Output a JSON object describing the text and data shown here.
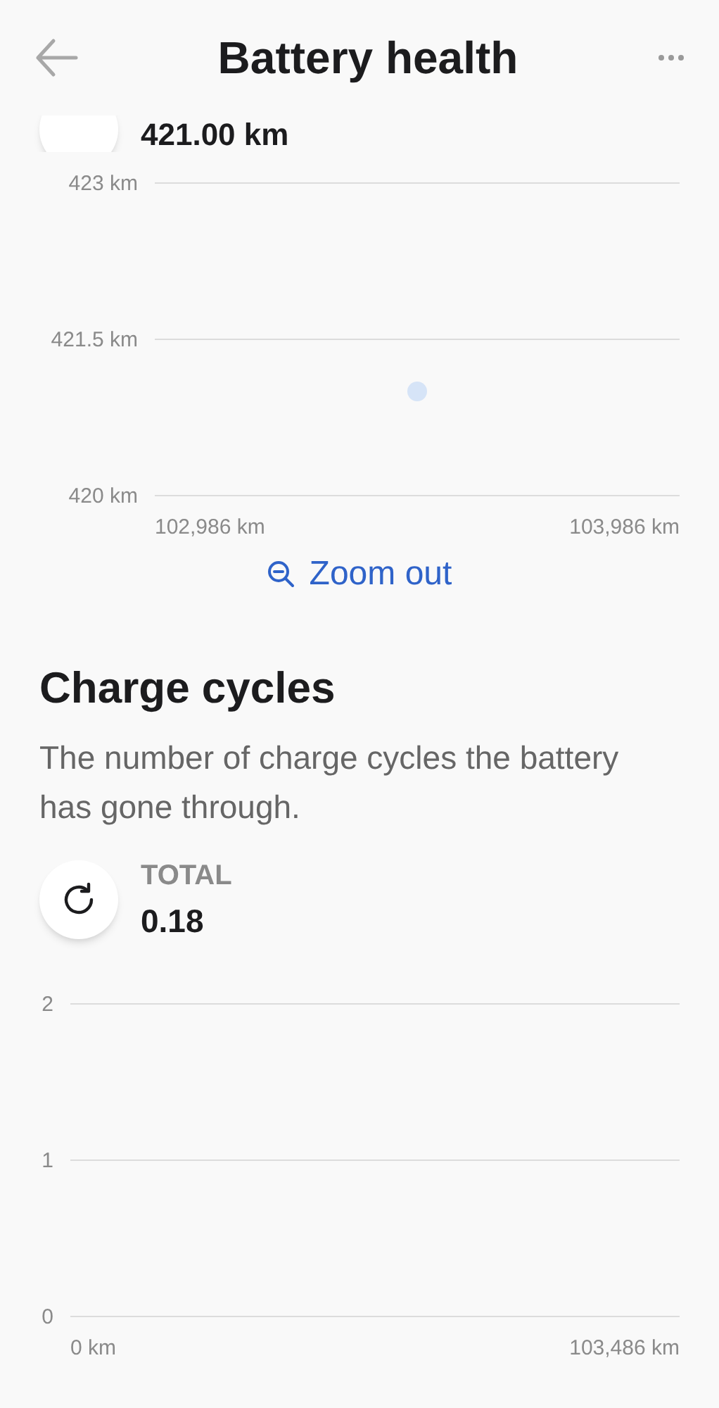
{
  "header": {
    "title": "Battery health"
  },
  "range": {
    "value": "421.00 km",
    "chart_data": {
      "type": "scatter",
      "ylim": [
        420,
        423
      ],
      "yticks": [
        {
          "value": 420,
          "label": "420 km"
        },
        {
          "value": 421.5,
          "label": "421.5 km"
        },
        {
          "value": 423,
          "label": "423 km"
        }
      ],
      "xlim": [
        102853,
        104119
      ],
      "xticks": [
        {
          "value": 102986,
          "label": "102,986 km"
        },
        {
          "value": 103986,
          "label": "103,986 km"
        }
      ],
      "x": [
        103486
      ],
      "series": [
        {
          "color": "#d6e4f7",
          "values": [
            421.0
          ]
        }
      ]
    }
  },
  "zoom_out": {
    "label": "Zoom out"
  },
  "charge_cycles": {
    "title": "Charge cycles",
    "description": "The number of charge cycles the battery has gone through.",
    "total_label": "TOTAL",
    "total_value": "0.18",
    "chart_data": {
      "type": "line",
      "ylim": [
        0,
        2
      ],
      "yticks": [
        {
          "value": 0,
          "label": "0"
        },
        {
          "value": 1,
          "label": "1"
        },
        {
          "value": 2,
          "label": "2"
        }
      ],
      "xlim": [
        -4456,
        114229
      ],
      "xticks": [
        {
          "value": 0,
          "label": "0 km"
        },
        {
          "value": 103486,
          "label": "103,486 km"
        }
      ]
    }
  }
}
